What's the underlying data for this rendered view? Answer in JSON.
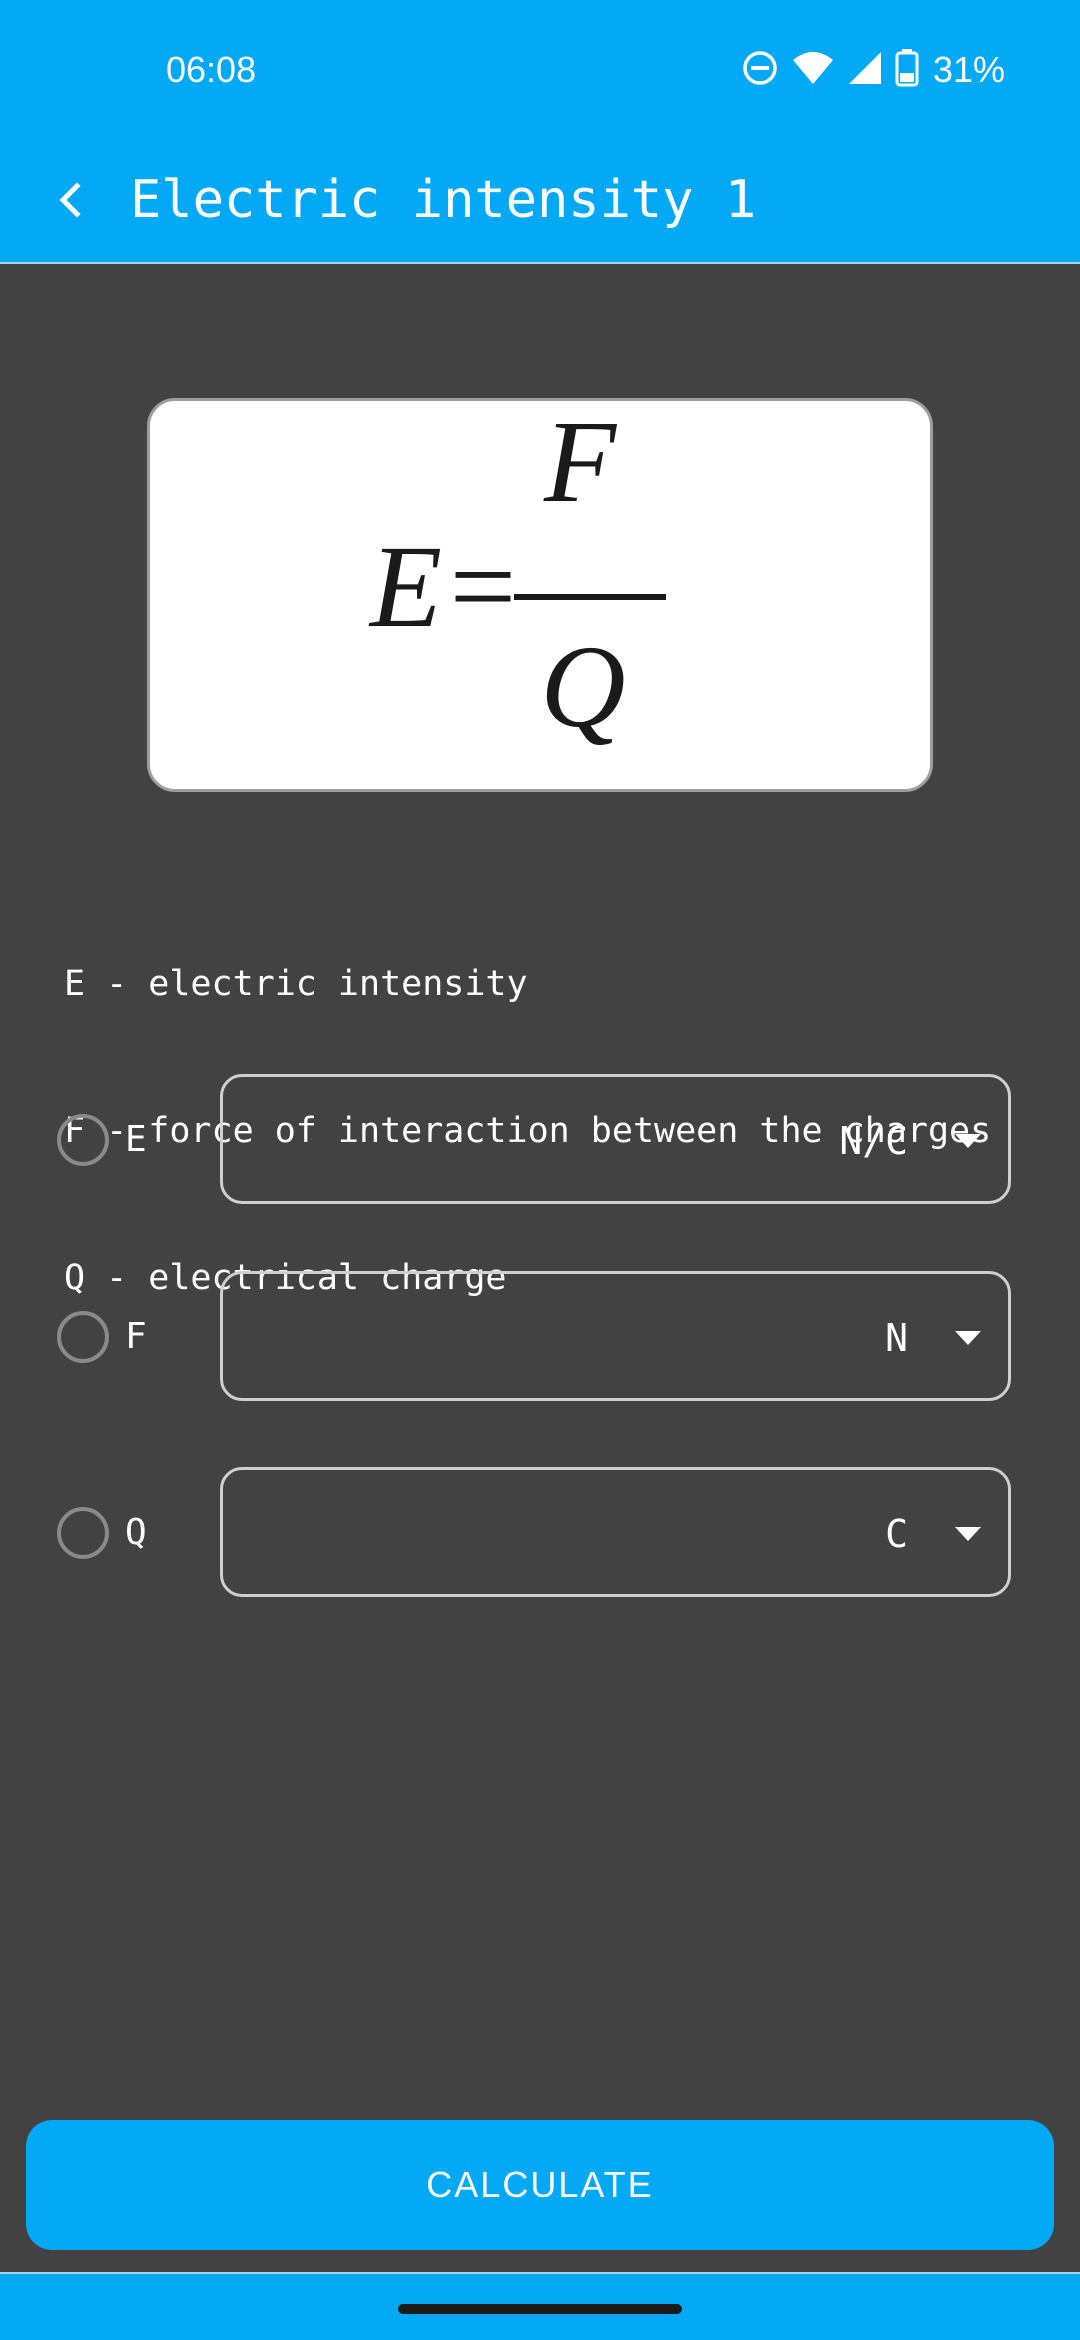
{
  "status_bar": {
    "time": "06:08",
    "battery": "31%",
    "icons": [
      "do-not-disturb-icon",
      "wifi-icon",
      "signal-icon",
      "battery-icon"
    ]
  },
  "app_bar": {
    "title": "Electric intensity 1",
    "back_icon": "chevron-left-icon"
  },
  "formula": {
    "lhs": "E=",
    "numerator": "F",
    "denominator": "Q"
  },
  "legend": [
    "E - electric intensity",
    "F - force of interaction between the charges",
    "Q - electrical charge"
  ],
  "variables": [
    {
      "name": "E",
      "value": "",
      "unit": "N/C",
      "selected": false
    },
    {
      "name": "F",
      "value": "",
      "unit": "N",
      "selected": false
    },
    {
      "name": "Q",
      "value": "",
      "unit": "C",
      "selected": false
    }
  ],
  "calculate_button": {
    "label": "CALCULATE"
  },
  "colors": {
    "accent": "#03a9f4",
    "background": "#424242",
    "text": "#ffffff",
    "outline": "#cfcfcf",
    "radio": "#8a8a8a"
  }
}
